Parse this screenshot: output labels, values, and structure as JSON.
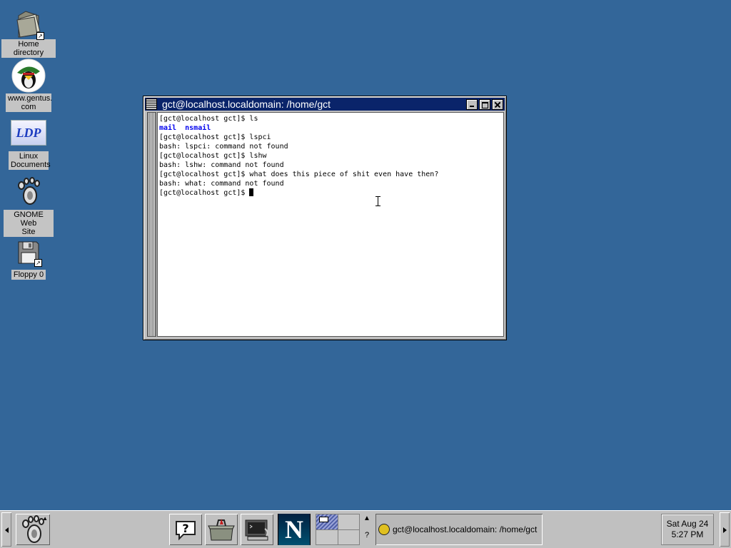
{
  "desktop": {
    "icons": [
      {
        "label": "Home directory",
        "icon": "folder-icon"
      },
      {
        "label": "www.gentus.\ncom",
        "icon": "gentus-logo-icon"
      },
      {
        "label": "Linux\nDocuments",
        "icon": "ldp-logo-icon",
        "logo_text": "LDP"
      },
      {
        "label": "GNOME Web\nSite",
        "icon": "gnome-foot-icon"
      },
      {
        "label": "Floppy 0",
        "icon": "floppy-icon"
      }
    ]
  },
  "terminal": {
    "title": "gct@localhost.localdomain: /home/gct",
    "lines": [
      "[gct@localhost gct]$ ls",
      "",
      "[gct@localhost gct]$ lspci",
      "bash: lspci: command not found",
      "[gct@localhost gct]$ lshw",
      "bash: lshw: command not found",
      "[gct@localhost gct]$ what does this piece of shit even have then?",
      "bash: what: command not found",
      "[gct@localhost gct]$ "
    ],
    "dir_entries": [
      "mail",
      "nsmail"
    ],
    "dir_color": "#0000ee"
  },
  "taskbar": {
    "launchers": [
      "help-icon",
      "toolbox-icon",
      "terminal-icon",
      "netscape-icon"
    ],
    "netscape_letter": "N",
    "pager_question": "?",
    "task_title": "gct@localhost.localdomain: /home/gct",
    "clock_date": "Sat Aug 24",
    "clock_time": "5:27 PM"
  },
  "colors": {
    "desktop": "#336699",
    "titlebar": "#0a246a",
    "panel": "#c0c0c0"
  }
}
